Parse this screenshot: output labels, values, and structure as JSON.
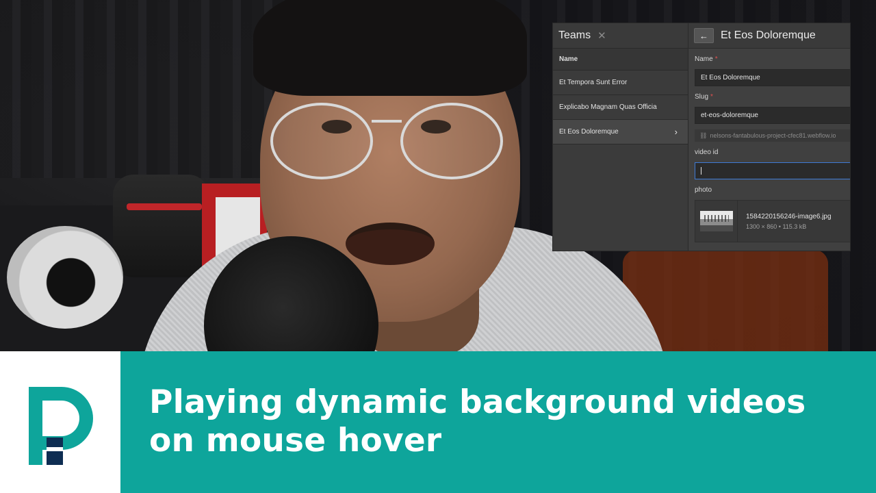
{
  "cms": {
    "collection_title": "Teams",
    "column_header": "Name",
    "items": [
      {
        "label": "Et Tempora Sunt Error"
      },
      {
        "label": "Explicabo Magnam Quas Officia"
      },
      {
        "label": "Et Eos Doloremque"
      }
    ],
    "selected_item": "Et Eos Doloremque",
    "editor": {
      "title": "Et Eos Doloremque",
      "name_label": "Name",
      "name_value": "Et Eos Doloremque",
      "slug_label": "Slug",
      "slug_value": "et-eos-doloremque",
      "url_preview": "nelsons-fantabulous-project-cfec81.webflow.io",
      "video_id_label": "video id",
      "video_id_value": "",
      "photo_label": "photo",
      "photo_filename": "1584220156246-image6.jpg",
      "photo_details": "1300 × 860 • 115.3 kB"
    }
  },
  "banner": {
    "headline_line1": "Playing dynamic background videos",
    "headline_line2": "on mouse hover"
  },
  "colors": {
    "brand_teal": "#0ea59b",
    "logo_navy": "#0e2d52",
    "required_marker": "#e05050",
    "focus_border": "#3f7bd6"
  },
  "icons": {
    "close": "close-icon",
    "back": "arrow-left-icon",
    "chevron": "chevron-right-icon",
    "link": "link-icon"
  }
}
